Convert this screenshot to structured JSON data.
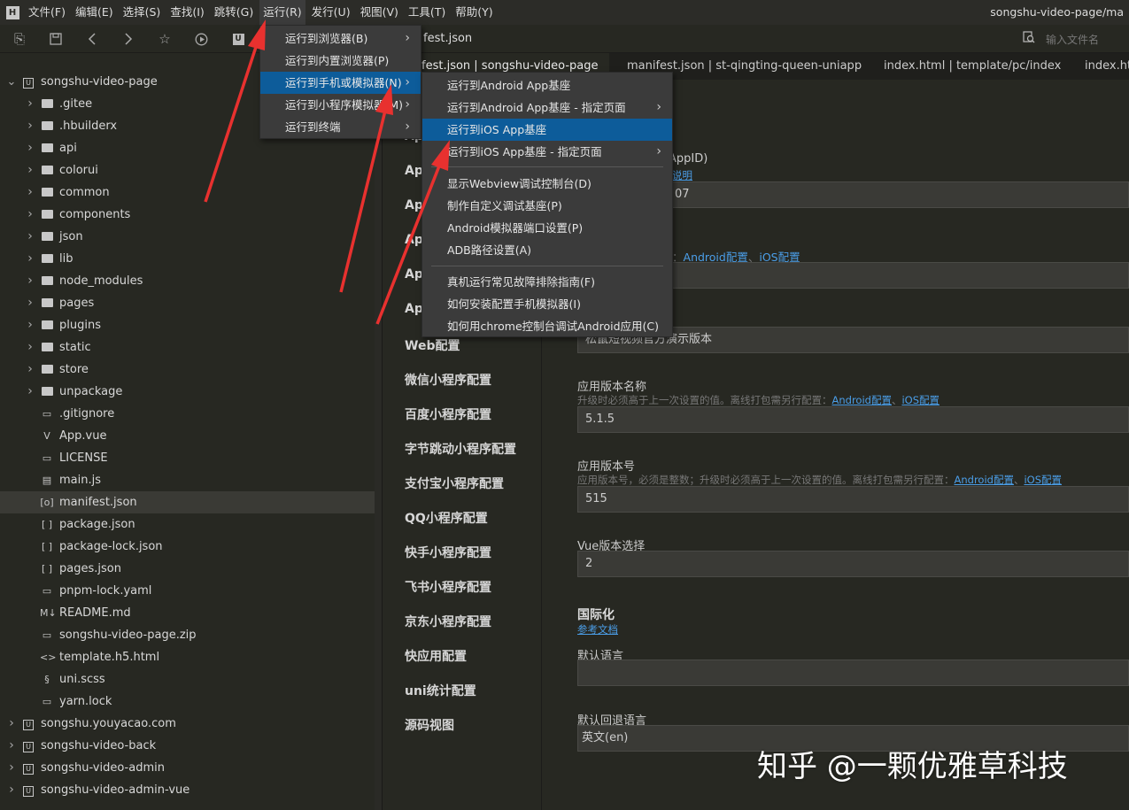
{
  "menubar": {
    "items": [
      "文件(F)",
      "编辑(E)",
      "选择(S)",
      "查找(I)",
      "跳转(G)",
      "运行(R)",
      "发行(U)",
      "视图(V)",
      "工具(T)",
      "帮助(Y)"
    ],
    "title_path": "songshu-video-page/ma"
  },
  "toolbar": {
    "tab_label": "fest.json",
    "file_search_placeholder": "输入文件名"
  },
  "sidebar": {
    "tree": [
      {
        "label": "songshu-video-page",
        "type": "project",
        "level": 0,
        "expanded": true
      },
      {
        "label": ".gitee",
        "type": "folder",
        "level": 1
      },
      {
        "label": ".hbuilderx",
        "type": "folder",
        "level": 1
      },
      {
        "label": "api",
        "type": "folder",
        "level": 1
      },
      {
        "label": "colorui",
        "type": "folder",
        "level": 1
      },
      {
        "label": "common",
        "type": "folder",
        "level": 1
      },
      {
        "label": "components",
        "type": "folder",
        "level": 1
      },
      {
        "label": "json",
        "type": "folder",
        "level": 1
      },
      {
        "label": "lib",
        "type": "folder",
        "level": 1
      },
      {
        "label": "node_modules",
        "type": "folder",
        "level": 1
      },
      {
        "label": "pages",
        "type": "folder",
        "level": 1
      },
      {
        "label": "plugins",
        "type": "folder",
        "level": 1
      },
      {
        "label": "static",
        "type": "folder",
        "level": 1
      },
      {
        "label": "store",
        "type": "folder",
        "level": 1
      },
      {
        "label": "unpackage",
        "type": "folder",
        "level": 1
      },
      {
        "label": ".gitignore",
        "type": "file",
        "level": 1
      },
      {
        "label": "App.vue",
        "type": "vue",
        "level": 1
      },
      {
        "label": "LICENSE",
        "type": "file",
        "level": 1
      },
      {
        "label": "main.js",
        "type": "js",
        "level": 1
      },
      {
        "label": "manifest.json",
        "type": "manifest",
        "level": 1,
        "selected": true
      },
      {
        "label": "package.json",
        "type": "json",
        "level": 1
      },
      {
        "label": "package-lock.json",
        "type": "json",
        "level": 1
      },
      {
        "label": "pages.json",
        "type": "json",
        "level": 1
      },
      {
        "label": "pnpm-lock.yaml",
        "type": "file",
        "level": 1
      },
      {
        "label": "README.md",
        "type": "md",
        "level": 1
      },
      {
        "label": "songshu-video-page.zip",
        "type": "file",
        "level": 1
      },
      {
        "label": "template.h5.html",
        "type": "html",
        "level": 1
      },
      {
        "label": "uni.scss",
        "type": "scss",
        "level": 1
      },
      {
        "label": "yarn.lock",
        "type": "file",
        "level": 1
      },
      {
        "label": "songshu.youyacao.com",
        "type": "project",
        "level": 0
      },
      {
        "label": "songshu-video-back",
        "type": "project",
        "level": 0
      },
      {
        "label": "songshu-video-admin",
        "type": "project",
        "level": 0
      },
      {
        "label": "songshu-video-admin-vue",
        "type": "project",
        "level": 0
      }
    ]
  },
  "editor_tabs": [
    {
      "label": "fest.json | songshu-video-page",
      "active": true
    },
    {
      "label": "manifest.json | st-qingting-queen-uniapp"
    },
    {
      "label": "index.html | template/pc/index"
    },
    {
      "label": "index.ht"
    }
  ],
  "settings_nav": [
    {
      "label": "Ap"
    },
    {
      "label": "Ap"
    },
    {
      "label": "Ap"
    },
    {
      "label": "Ap"
    },
    {
      "label": "Ap"
    },
    {
      "label": "Ap"
    },
    {
      "label": "Web配置"
    },
    {
      "label": "微信小程序配置"
    },
    {
      "label": "百度小程序配置"
    },
    {
      "label": "字节跳动小程序配置"
    },
    {
      "label": "支付宝小程序配置"
    },
    {
      "label": "QQ小程序配置"
    },
    {
      "label": "快手小程序配置"
    },
    {
      "label": "飞书小程序配置"
    },
    {
      "label": "京东小程序配置"
    },
    {
      "label": "快应用配置"
    },
    {
      "label": "uni统计配置"
    },
    {
      "label": "源码视图"
    }
  ],
  "settings": {
    "appid_label_tail": "AppID)",
    "appid_link_tail": "说明",
    "appid_value_tail": "07",
    "name_hint_links": [
      "Android配置",
      "iOS配置"
    ],
    "name_hint_sep": "、",
    "name_hint_prefix": "：",
    "description_value": "松鼠短视频官方演示版本",
    "version_name_label": "应用版本名称",
    "version_name_hint": "升级时必须高于上一次设置的值。离线打包需另行配置：",
    "version_name_value": "5.1.5",
    "version_code_label": "应用版本号",
    "version_code_hint": "应用版本号，必须是整数；升级时必须高于上一次设置的值。离线打包需另行配置：",
    "version_code_value": "515",
    "link_android": "Android配置",
    "link_ios": "iOS配置",
    "vue_version_label": "Vue版本选择",
    "vue_version_value": "2",
    "i18n_title": "国际化",
    "i18n_doc_link": "参考文档",
    "default_locale_label": "默认语言",
    "default_locale_value": "",
    "fallback_locale_label": "默认回退语言",
    "fallback_locale_value": "英文(en)"
  },
  "run_menu": {
    "items": [
      {
        "label": "运行到浏览器(B)",
        "submenu": true
      },
      {
        "label": "运行到内置浏览器(P)"
      },
      {
        "label": "运行到手机或模拟器(N)",
        "submenu": true,
        "highlighted": true
      },
      {
        "label": "运行到小程序模拟器(M)",
        "submenu": true
      },
      {
        "label": "运行到终端",
        "submenu": true
      }
    ]
  },
  "device_submenu": {
    "items": [
      {
        "label": "运行到Android App基座"
      },
      {
        "label": "运行到Android App基座 - 指定页面",
        "submenu": true
      },
      {
        "label": "运行到iOS App基座",
        "highlighted": true
      },
      {
        "label": "运行到iOS App基座 - 指定页面",
        "submenu": true
      },
      {
        "separator": true
      },
      {
        "label": "显示Webview调试控制台(D)"
      },
      {
        "label": "制作自定义调试基座(P)"
      },
      {
        "label": "Android模拟器端口设置(P)"
      },
      {
        "label": "ADB路径设置(A)"
      },
      {
        "separator": true
      },
      {
        "label": "真机运行常见故障排除指南(F)"
      },
      {
        "label": "如何安装配置手机模拟器(I)"
      },
      {
        "label": "如何用chrome控制台调试Android应用(C)"
      }
    ]
  },
  "watermark": "知乎 @一颗优雅草科技",
  "colors": {
    "background": "#272822",
    "menu_highlight": "#0d5c9a",
    "link": "#4b9ee8",
    "annotation_arrow": "#e8312f"
  },
  "icons": {
    "chevron_right": "›",
    "chevron_down": "⌄",
    "file": "▭",
    "json": "[ ]",
    "vue": "V",
    "md": "M↓",
    "html": "<>",
    "scss": "§",
    "js": "▤",
    "manifest": "[o]"
  }
}
